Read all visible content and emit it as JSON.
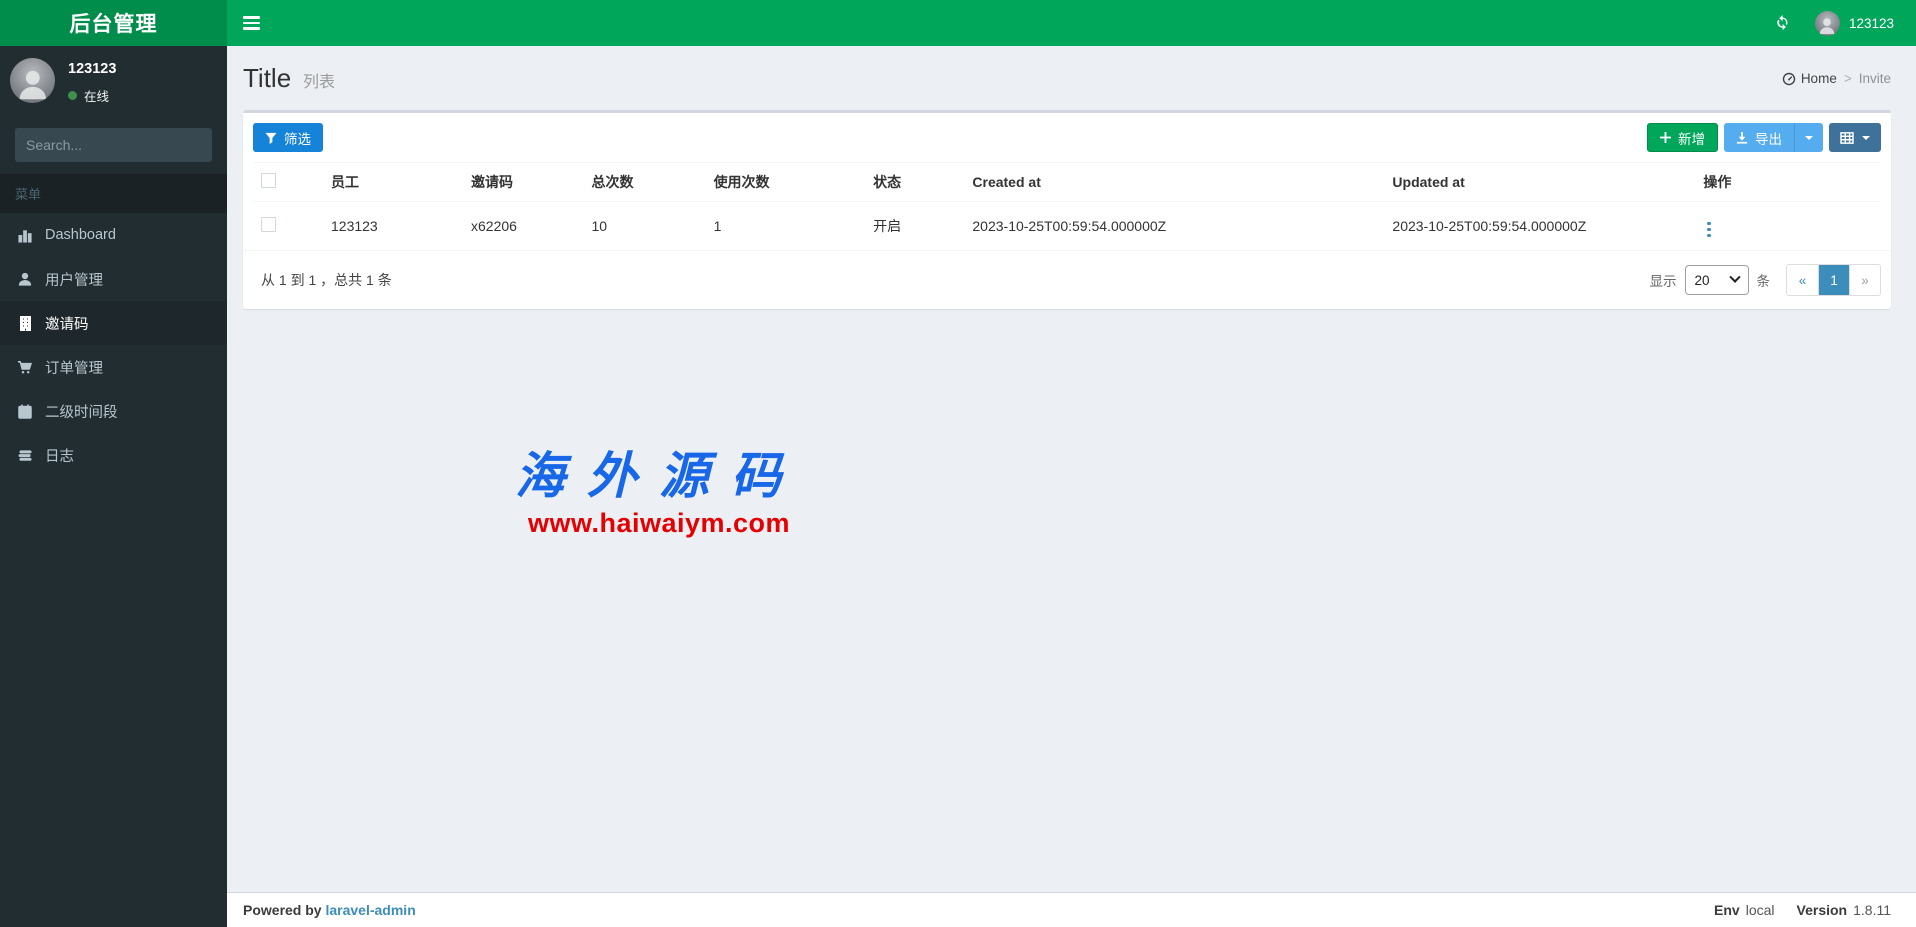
{
  "navbar": {
    "logo": "后台管理",
    "username": "123123"
  },
  "sidebar": {
    "user_name": "123123",
    "user_status": "在线",
    "search_placeholder": "Search...",
    "menu_header": "菜单",
    "items": [
      {
        "label": "Dashboard",
        "icon": "bar-chart-icon",
        "active": false
      },
      {
        "label": "用户管理",
        "icon": "user-icon",
        "active": false
      },
      {
        "label": "邀请码",
        "icon": "building-icon",
        "active": true
      },
      {
        "label": "订单管理",
        "icon": "cart-icon",
        "active": false
      },
      {
        "label": "二级时间段",
        "icon": "calendar-check-icon",
        "active": false
      },
      {
        "label": "日志",
        "icon": "log-lines-icon",
        "active": false
      }
    ]
  },
  "header": {
    "title": "Title",
    "subtitle": "列表",
    "breadcrumb_home": "Home",
    "breadcrumb_separator": ">",
    "breadcrumb_current": "Invite"
  },
  "toolbar": {
    "filter_label": "筛选",
    "create_label": "新增",
    "export_label": "导出"
  },
  "table": {
    "columns": {
      "staff": "员工",
      "code": "邀请码",
      "total": "总次数",
      "used": "使用次数",
      "status": "状态",
      "created": "Created at",
      "updated": "Updated at",
      "actions": "操作"
    },
    "rows": [
      {
        "staff": "123123",
        "code": "x62206",
        "total": "10",
        "used": "1",
        "status": "开启",
        "created": "2023-10-25T00:59:54.000000Z",
        "updated": "2023-10-25T00:59:54.000000Z"
      }
    ]
  },
  "pagination": {
    "summary": "从 1 到 1 ，总共 1 条",
    "show_label": "显示",
    "per_page": "20",
    "unit_label": "条",
    "prev": "«",
    "current_page": "1",
    "next": "»"
  },
  "watermark": {
    "title": "海外源码",
    "url": "www.haiwaiym.com"
  },
  "footer": {
    "powered_by": "Powered by",
    "brand": "laravel-admin",
    "env_label": "Env",
    "env_value": "local",
    "version_label": "Version",
    "version_value": "1.8.11"
  },
  "colors": {
    "green": "#00a65a",
    "green-dark": "#008d4c",
    "sidebar-bg": "#222d32",
    "sidebar-text": "#b8c7ce",
    "sidebar-active-bg": "#1e282c",
    "content-bg": "#ecf0f5",
    "primary-blue": "#1583d8",
    "export-blue": "#55acee",
    "column-blue": "#3f729b",
    "pager-active": "#3c8dbc",
    "link-blue": "#3c8dbc",
    "watermark-blue": "#1767e8",
    "watermark-red": "#e60000"
  }
}
